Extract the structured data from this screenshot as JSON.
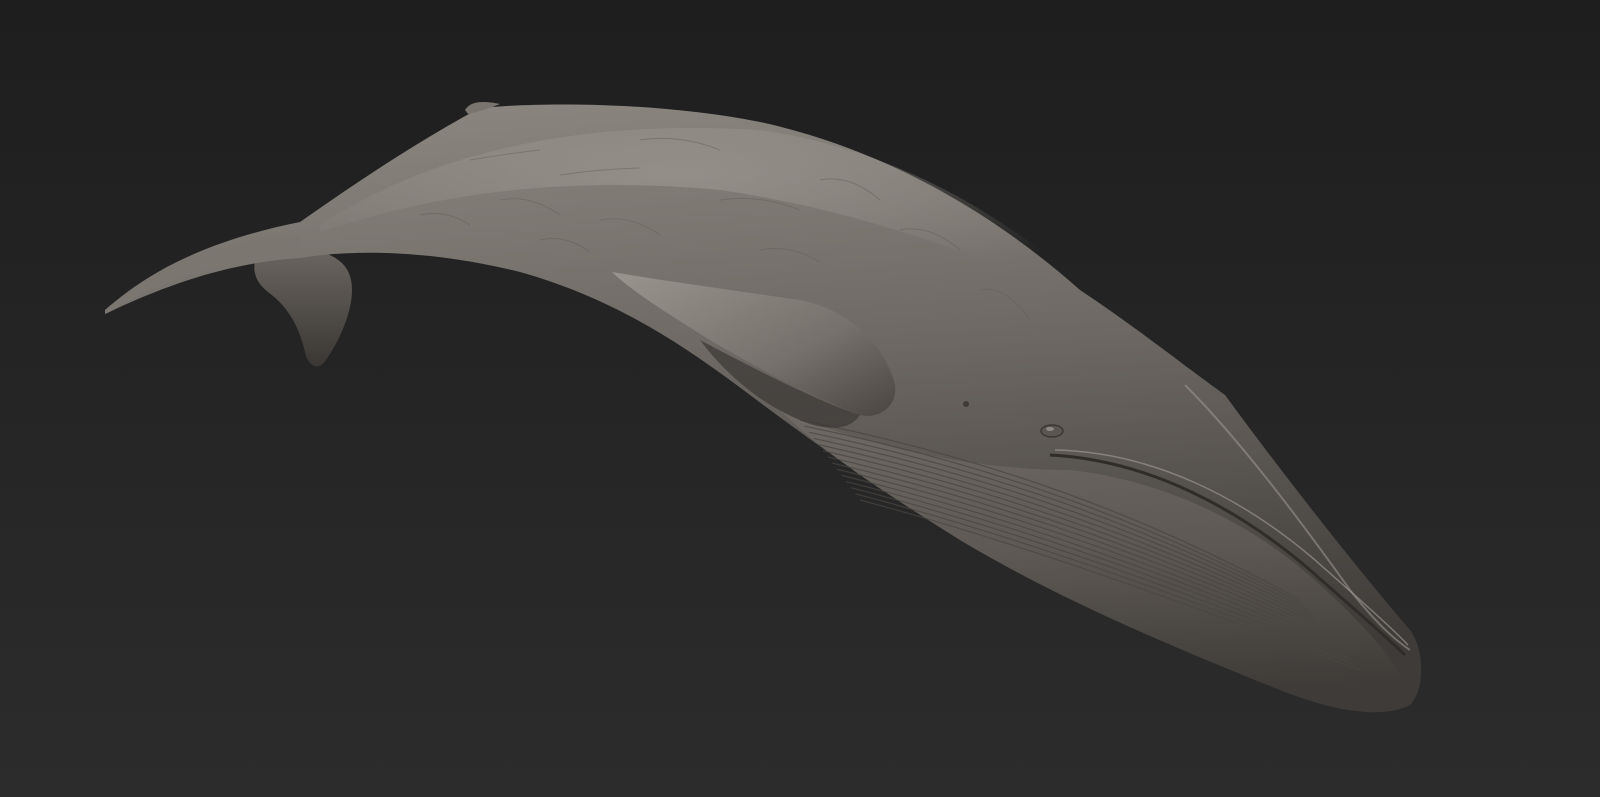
{
  "scene": {
    "subject": "whale-sculpt",
    "colors": {
      "background_top": "#1e1e1e",
      "background_bottom": "#2c2c2c",
      "body_light": "#8d8781",
      "body_mid": "#6f6a65",
      "body_dark": "#3e3b38",
      "belly": "#5e5954",
      "groove": "#4a4541"
    }
  }
}
